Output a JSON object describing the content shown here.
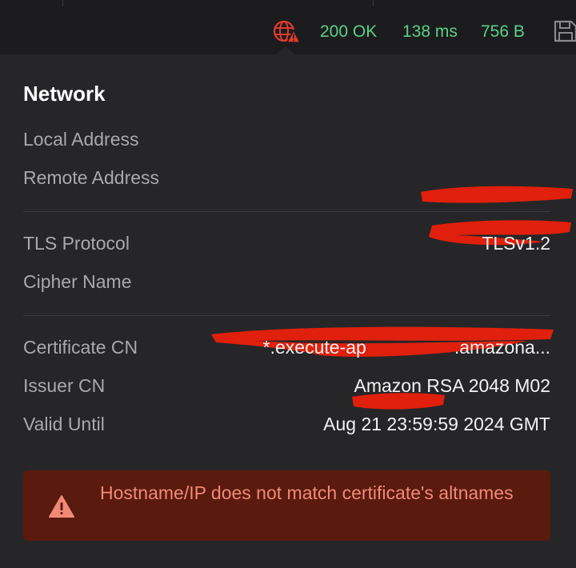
{
  "status": {
    "code": "200 OK",
    "time": "138 ms",
    "size": "756 B",
    "status_color": "#5bd08a",
    "icons": [
      "globe-warning-icon",
      "save-icon"
    ]
  },
  "network": {
    "title": "Network",
    "local_address_label": "Local Address",
    "remote_address_label": "Remote Address",
    "tls_protocol_label": "TLS Protocol",
    "tls_protocol_value": "TLSv1.2",
    "cipher_name_label": "Cipher Name",
    "certificate_cn_label": "Certificate CN",
    "certificate_cn_prefix": "*.execute-ap",
    "certificate_cn_suffix": ".amazona...",
    "issuer_cn_label": "Issuer CN",
    "issuer_cn_value": "Amazon RSA 2048 M02",
    "valid_until_label": "Valid Until",
    "valid_until_value": "Aug 21 23:59:59 2024 GMT"
  },
  "alert": {
    "message": "Hostname/IP does not match certificate's altnames",
    "background": "#5a1a0e",
    "text_color": "#f08a76",
    "icon": "warning-icon"
  },
  "redaction_color": "#e0200c"
}
